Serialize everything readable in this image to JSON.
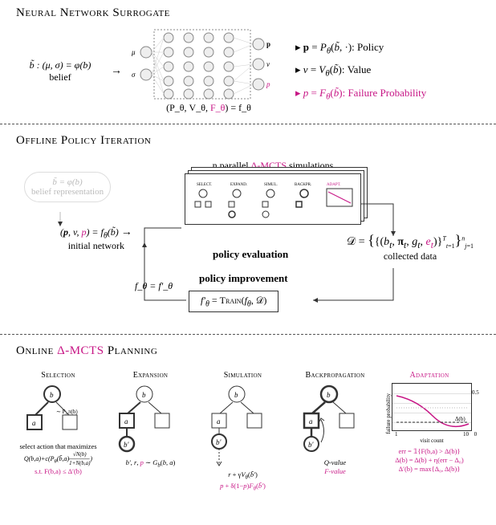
{
  "section1": {
    "title": "Neural Network Surrogate",
    "belief_eq": "b̃ : (μ, σ) = φ(b)",
    "belief_label": "belief",
    "mu": "μ",
    "sigma": "σ",
    "p_out": "p",
    "v_out": "v",
    "fp_out": "p",
    "nn_caption_pre": "(P_θ, V_θ, ",
    "nn_caption_f": "F_θ",
    "nn_caption_post": ") = f_θ",
    "policy_eq": "p = P_θ(b̃, ·): Policy",
    "value_eq": "v = V_θ(b̃): Value",
    "failure_eq": "p = F_θ(b̃): Failure Probability"
  },
  "section2": {
    "title": "Offline Policy Iteration",
    "belief_eq": "b̃ = φ(b)",
    "belief_label": "belief representation",
    "init_eq_pre": "(p, v, ",
    "init_eq_p": "p",
    "init_eq_post": ") = f_θ(b̃)",
    "init_label": "initial network",
    "sim_pre": "n parallel ",
    "sim_delta": "Δ-MCTS",
    "sim_post": " simulations",
    "policy_eval": "policy evaluation",
    "policy_improve": "policy improvement",
    "ftheta_eq": "f_θ = f′_θ",
    "train_eq": "f′_θ = Train(f_θ, 𝒟)",
    "data_eq_pre": "𝒟 = { {(b_t, π_t, g_t, ",
    "data_eq_e": "e_t",
    "data_eq_post": ")}_{t=1}^T }_{j=1}^n",
    "data_label": "collected data"
  },
  "section3": {
    "title_pre": "Online ",
    "title_delta": "Δ-MCTS",
    "title_post": " Planning",
    "stages": {
      "selection": {
        "name": "Selection",
        "sample": "∼ P_π(b)",
        "desc": "select action that maximizes",
        "eq": "Q(b,a) + c(P_θ(b̃,a) √N(b)/(1+N(b,a)))",
        "constraint": "s.t. F(b,a) ≤ Δ′(b)"
      },
      "expansion": {
        "name": "Expansion",
        "eq_pre": "b′, r, ",
        "eq_p": "p",
        "eq_post": " ∼ G_b(b, a)"
      },
      "simulation": {
        "name": "Simulation",
        "eq1": "r + γV_θ(b̃′)",
        "eq2": "p + δ(1−p)F_θ(b̃′)"
      },
      "backprop": {
        "name": "Backpropagation",
        "q": "Q-value",
        "f": "F-value"
      },
      "adaptation": {
        "name": "Adaptation",
        "ylabel": "failure probability",
        "xlabel": "visit count",
        "delta_label": "Δ(b)",
        "xticks": [
          "1",
          "10"
        ],
        "yticks": [
          "0",
          "0.5"
        ],
        "eq1": "err = 𝟙{F(b,a) > Δ(b)}",
        "eq2": "Δ(b) = Δ(b) + η(err − Δ₀)",
        "eq3": "Δ′(b) = max{Δ₀, Δ(b)}"
      }
    }
  }
}
